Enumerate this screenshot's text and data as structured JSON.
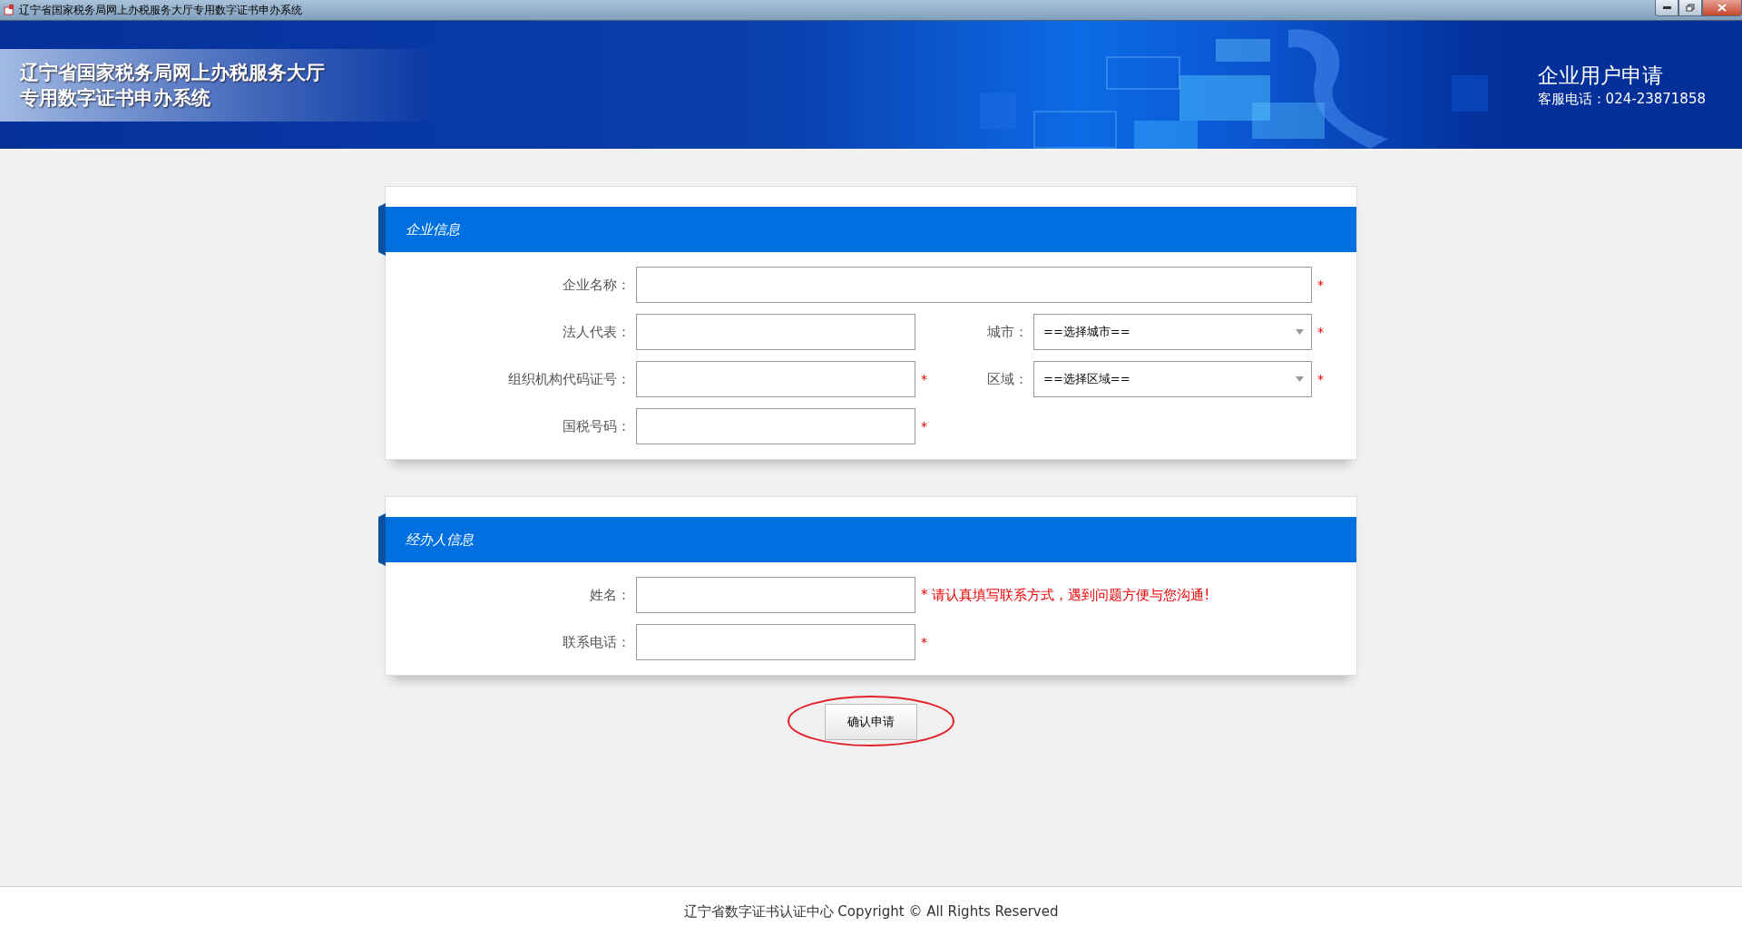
{
  "window": {
    "title": "辽宁省国家税务局网上办税服务大厅专用数字证书申办系统"
  },
  "header": {
    "title_lines": [
      "辽宁省国家税务局网上办税服务大厅",
      "专用数字证书申办系统"
    ],
    "heading": "企业用户申请",
    "hotline": "客服电话：024-23871858"
  },
  "sections": [
    {
      "title": "企业信息",
      "rows": [
        {
          "fields": [
            {
              "label": "企业名称：",
              "kind": "wide",
              "mark": "*"
            }
          ]
        },
        {
          "fields": [
            {
              "label": "法人代表：",
              "kind": "text"
            },
            {
              "label": "城市：",
              "kind": "select",
              "value": "==选择城市==",
              "mark": "*"
            }
          ]
        },
        {
          "fields": [
            {
              "label": "组织机构代码证号：",
              "kind": "text",
              "mark": "*"
            },
            {
              "label": "区域：",
              "kind": "select",
              "value": "==选择区域==",
              "mark": "*"
            }
          ]
        },
        {
          "fields": [
            {
              "label": "国税号码：",
              "kind": "text",
              "mark": "*"
            }
          ]
        }
      ]
    },
    {
      "title": "经办人信息",
      "rows": [
        {
          "fields": [
            {
              "label": "姓名：",
              "kind": "text",
              "mark": "*",
              "note": "请认真填写联系方式，遇到问题方便与您沟通!"
            }
          ]
        },
        {
          "fields": [
            {
              "label": "联系电话：",
              "kind": "text",
              "mark": "*"
            }
          ]
        }
      ]
    }
  ],
  "submit": {
    "label": "确认申请",
    "circled": true
  },
  "footer": "辽宁省数字证书认证中心 Copyright © All Rights Reserved"
}
